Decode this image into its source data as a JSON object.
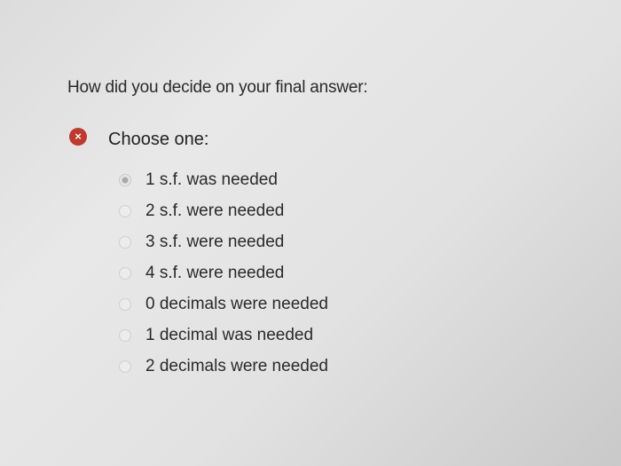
{
  "question": {
    "text": "How did you decide on your final answer:"
  },
  "status": {
    "icon": "error-icon",
    "glyph": "×",
    "color": "#c0392b"
  },
  "prompt": "Choose one:",
  "options": [
    {
      "label": "1 s.f. was needed",
      "selected": true
    },
    {
      "label": "2 s.f. were needed",
      "selected": false
    },
    {
      "label": "3 s.f. were needed",
      "selected": false
    },
    {
      "label": "4 s.f.  were needed",
      "selected": false
    },
    {
      "label": "0 decimals  were needed",
      "selected": false
    },
    {
      "label": "1 decimal was needed",
      "selected": false
    },
    {
      "label": "2 decimals were needed",
      "selected": false
    }
  ]
}
